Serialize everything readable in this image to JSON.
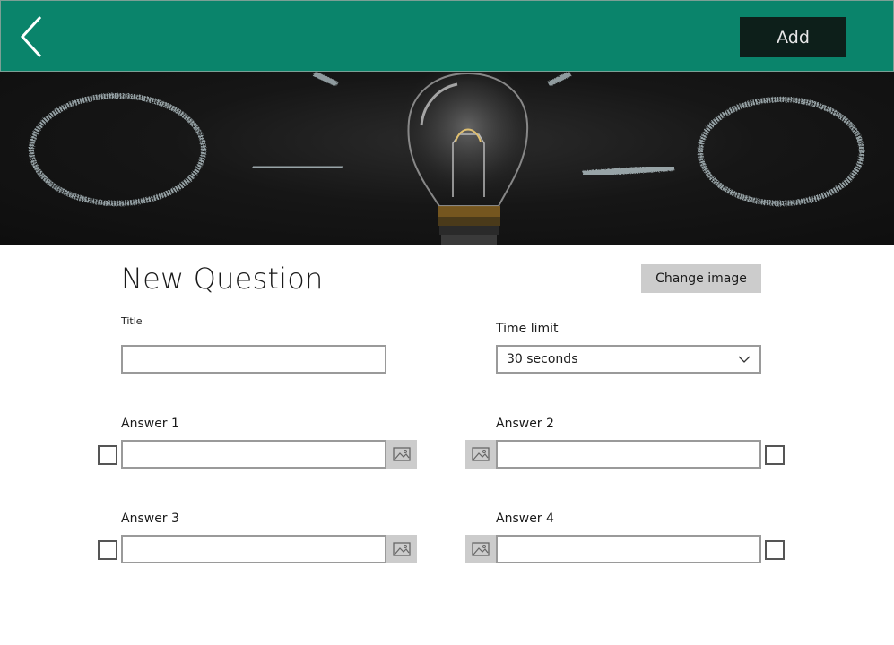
{
  "header": {
    "back_icon": "chevron-left-icon",
    "add_label": "Add",
    "bg_color": "#0a846b"
  },
  "hero": {
    "image_name": "lightbulb-chalkboard-image"
  },
  "form": {
    "page_title": "New Question",
    "change_image_label": "Change image",
    "title_label": "Title",
    "title_value": "",
    "time_limit_label": "Time limit",
    "time_limit_value": "30 seconds",
    "answers": [
      {
        "label": "Answer 1",
        "value": ""
      },
      {
        "label": "Answer 2",
        "value": ""
      },
      {
        "label": "Answer 3",
        "value": ""
      },
      {
        "label": "Answer 4",
        "value": ""
      }
    ],
    "image_icon": "image-icon",
    "checkbox_icon": "checkbox-icon"
  }
}
